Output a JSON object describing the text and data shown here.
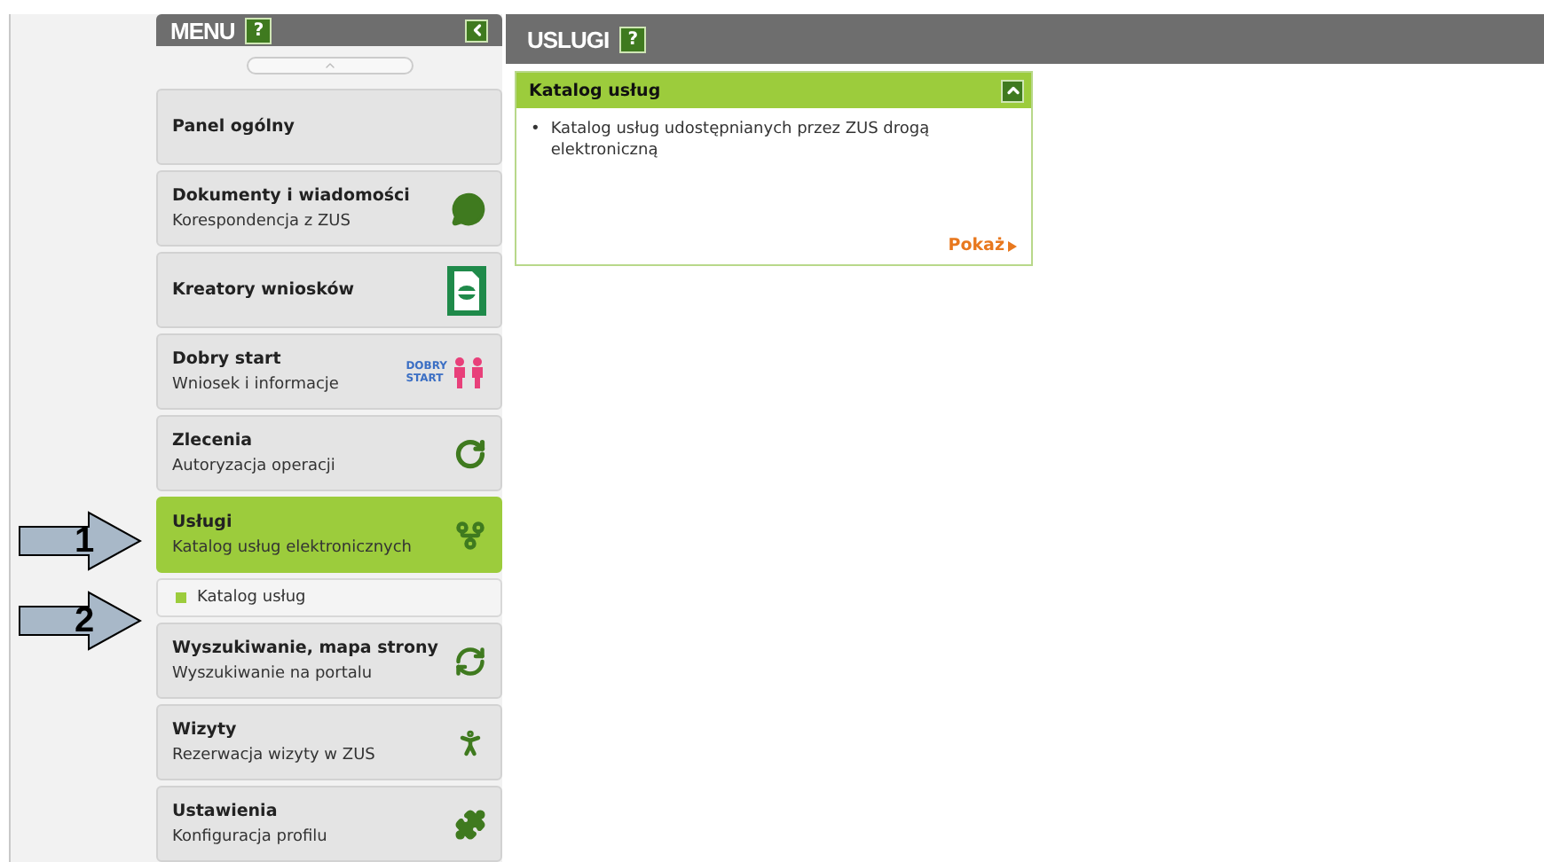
{
  "menu": {
    "title": "MENU",
    "help": "?",
    "items": [
      {
        "title": "Panel ogólny",
        "selected": false
      },
      {
        "title": "Dokumenty i wiadomości",
        "subtitle": "Korespondencja z ZUS",
        "selected": false
      },
      {
        "title": "Kreatory wniosków",
        "selected": false
      },
      {
        "title": "Dobry start",
        "subtitle": "Wniosek i informacje",
        "logo_text": [
          "DOBRY",
          "START"
        ],
        "selected": false
      },
      {
        "title": "Zlecenia",
        "subtitle": "Autoryzacja operacji",
        "selected": false
      },
      {
        "title": "Usługi",
        "subtitle": "Katalog usług elektronicznych",
        "selected": true,
        "children": [
          {
            "label": "Katalog usług",
            "selected": false
          }
        ]
      },
      {
        "title": "Wyszukiwanie, mapa strony",
        "subtitle": "Wyszukiwanie na portalu",
        "selected": false
      },
      {
        "title": "Wizyty",
        "subtitle": "Rezerwacja wizyty w ZUS",
        "selected": false
      },
      {
        "title": "Ustawienia",
        "subtitle": "Konfiguracja profilu",
        "selected": false
      }
    ]
  },
  "content": {
    "title": "USLUGI",
    "help": "?",
    "card": {
      "title": "Katalog usług",
      "bullet": "•",
      "bullets": [
        "Katalog usług udostępnianych przez ZUS drogą elektroniczną"
      ],
      "link": "Pokaż"
    }
  },
  "annotations": [
    {
      "label": "1"
    },
    {
      "label": "2"
    }
  ]
}
